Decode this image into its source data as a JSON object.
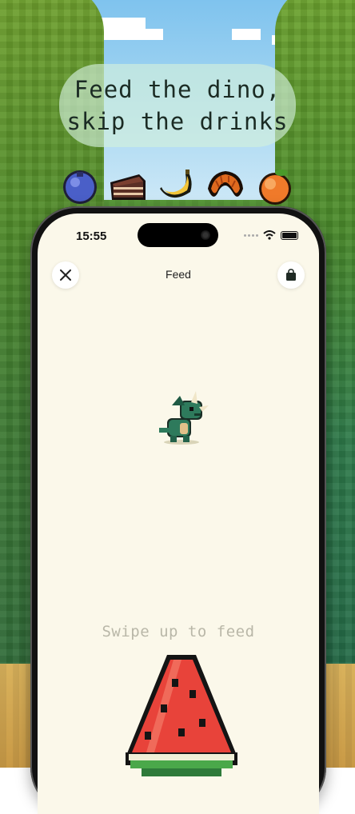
{
  "promo": {
    "headline_line1": "Feed the dino,",
    "headline_line2": "skip the drinks",
    "foods": [
      "blueberry-icon",
      "chocolate-cake-icon",
      "banana-icon",
      "croissant-icon",
      "peach-icon"
    ]
  },
  "status_bar": {
    "time": "15:55"
  },
  "nav": {
    "title": "Feed",
    "close_icon": "close-icon",
    "bag_icon": "shopping-bag-icon"
  },
  "feed": {
    "hint": "Swipe up to feed",
    "pet": "dino-icon",
    "current_food": "watermelon-icon"
  },
  "colors": {
    "screen_bg": "#fbf8ea",
    "hint_text": "#b9b7a8",
    "dino_green": "#2e7a5c"
  }
}
